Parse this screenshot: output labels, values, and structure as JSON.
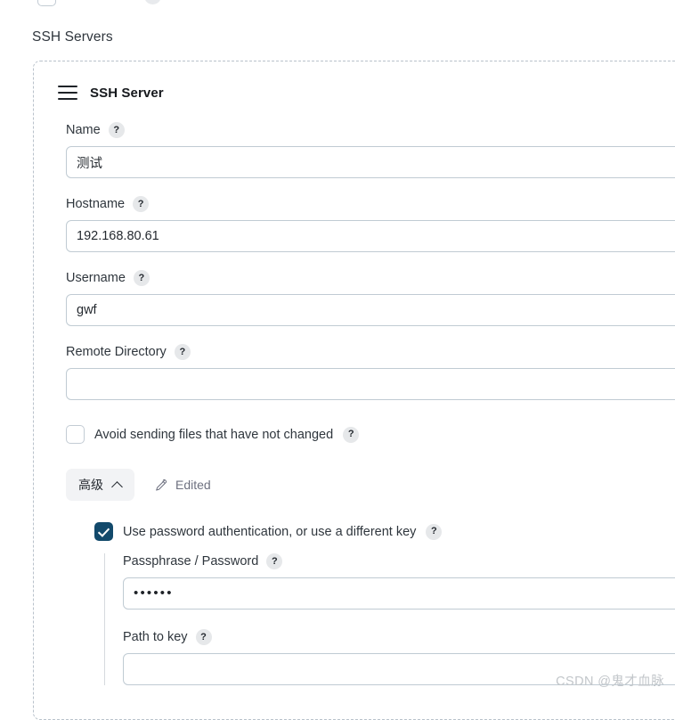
{
  "section": {
    "heading": "SSH Servers"
  },
  "card": {
    "title": "SSH Server",
    "drag_handle_icon": "hamburger-drag-icon",
    "help_glyph": "?"
  },
  "fields": [
    {
      "label": "Name",
      "value": "测试",
      "placeholder": "",
      "name": "name"
    },
    {
      "label": "Hostname",
      "value": "192.168.80.61",
      "placeholder": "",
      "name": "hostname"
    },
    {
      "label": "Username",
      "value": "gwf",
      "placeholder": "",
      "name": "username"
    },
    {
      "label": "Remote Directory",
      "value": "",
      "placeholder": "",
      "name": "remote-directory"
    }
  ],
  "avoid_sending": {
    "label": "Avoid sending files that have not changed",
    "checked": false
  },
  "advanced": {
    "button_label": "高级",
    "chevron_icon": "chevron-up-icon",
    "edited_label": "Edited",
    "pencil_icon": "pencil-icon",
    "expanded": true,
    "password_auth": {
      "label": "Use password authentication, or use a different key",
      "checked": true
    },
    "passphrase": {
      "label": "Passphrase / Password",
      "value": "••••••",
      "placeholder": ""
    },
    "path_to_key": {
      "label": "Path to key",
      "value": "",
      "placeholder": ""
    }
  },
  "watermark": {
    "text": "CSDN @鬼才血脉"
  },
  "colors": {
    "checkbox_checked": "#12496b",
    "input_border": "#c0cbd3",
    "card_dashed_border": "#b9c2cb",
    "help_badge_bg": "#e6e8ea",
    "advanced_btn_bg": "#f2f3f5",
    "edited_text": "#6e7180",
    "watermark": "#c2c6ca"
  }
}
